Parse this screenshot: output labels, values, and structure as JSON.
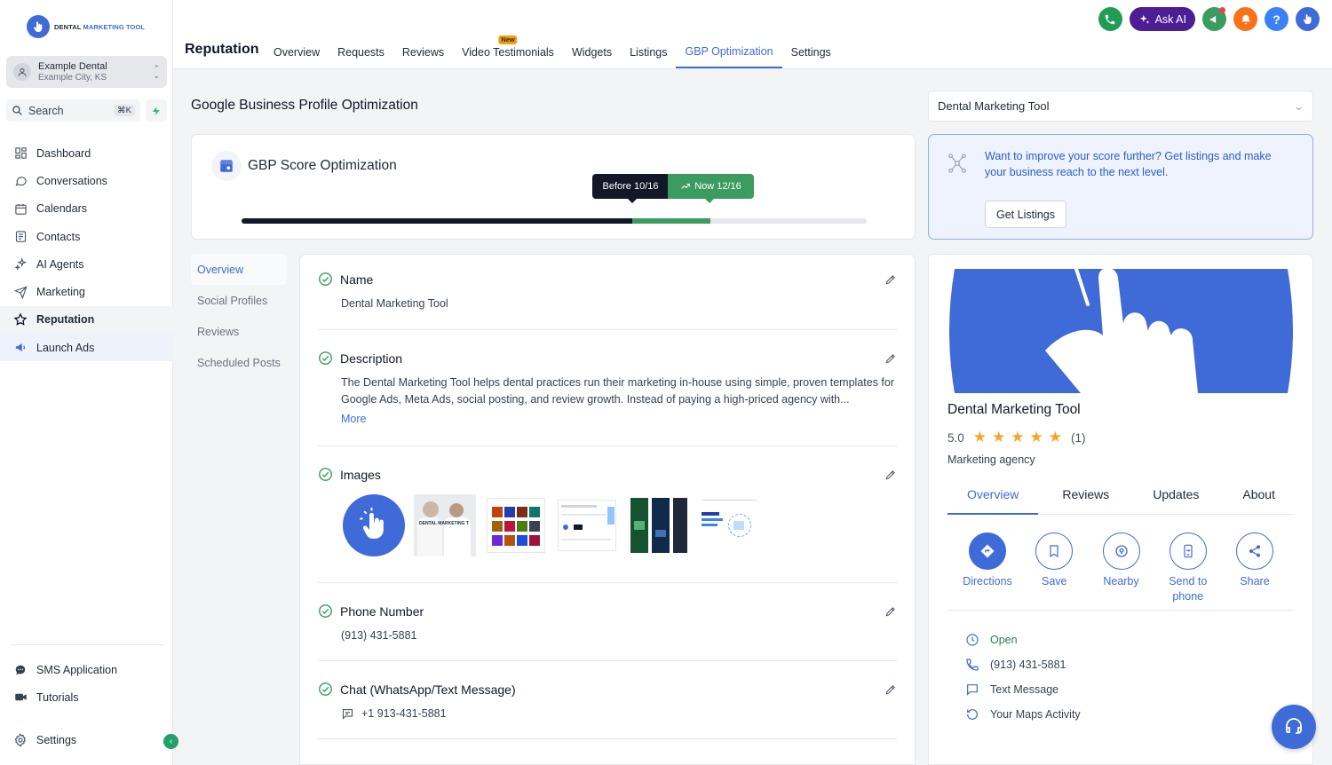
{
  "brand": {
    "logo_text_a": "DENTAL",
    "logo_text_b": "MARKETING TOOL",
    "accent": "#3f6bd8"
  },
  "location": {
    "name": "Example Dental",
    "sub": "Example City, KS"
  },
  "search": {
    "label": "Search",
    "shortcut": "⌘K"
  },
  "nav": {
    "items": [
      {
        "label": "Dashboard",
        "icon": "dashboard-icon"
      },
      {
        "label": "Conversations",
        "icon": "chat-bubble-icon"
      },
      {
        "label": "Calendars",
        "icon": "calendar-icon"
      },
      {
        "label": "Contacts",
        "icon": "contacts-icon"
      },
      {
        "label": "AI Agents",
        "icon": "sparkles-icon"
      },
      {
        "label": "Marketing",
        "icon": "send-icon"
      },
      {
        "label": "Reputation",
        "icon": "star-icon"
      },
      {
        "label": "Launch Ads",
        "icon": "megaphone-icon"
      }
    ],
    "bottom": [
      {
        "label": "SMS Application",
        "icon": "sms-icon"
      },
      {
        "label": "Tutorials",
        "icon": "video-icon"
      }
    ],
    "settings": "Settings"
  },
  "header": {
    "title": "Reputation",
    "tabs": [
      "Overview",
      "Requests",
      "Reviews",
      "Video Testimonials",
      "Widgets",
      "Listings",
      "GBP Optimization",
      "Settings"
    ],
    "new_badge": "New",
    "ask_ai": "Ask AI",
    "help": "?"
  },
  "main": {
    "title": "Google Business Profile Optimization",
    "select_value": "Dental Marketing Tool",
    "score": {
      "title": "GBP Score Optimization",
      "before_label": "Before 10/16",
      "now_label": "Now 12/16",
      "before_fraction": 0.625,
      "now_fraction": 0.75
    },
    "promo": {
      "text": "Want to improve your score further? Get listings and make your business reach to the next level.",
      "button": "Get Listings"
    },
    "side_tabs": [
      "Overview",
      "Social Profiles",
      "Reviews",
      "Scheduled Posts"
    ],
    "fields": {
      "name": {
        "label": "Name",
        "value": "Dental Marketing Tool"
      },
      "description": {
        "label": "Description",
        "value": "The Dental Marketing Tool helps dental practices run their marketing in-house using simple, proven templates for Google Ads, Meta Ads, social posting, and review growth. Instead of paying a high-priced agency with...",
        "more": "More"
      },
      "images": {
        "label": "Images",
        "thumb_caption": "DENTAL MARKETING T"
      },
      "phone": {
        "label": "Phone Number",
        "value": "(913) 431-5881"
      },
      "chat": {
        "label": "Chat (WhatsApp/Text Message)",
        "value": "+1 913-431-5881"
      }
    }
  },
  "profile": {
    "name": "Dental Marketing Tool",
    "rating": "5.0",
    "rating_count": "(1)",
    "stars": 5,
    "category": "Marketing agency",
    "tabs": [
      "Overview",
      "Reviews",
      "Updates",
      "About"
    ],
    "actions": [
      "Directions",
      "Save",
      "Nearby",
      "Send to phone",
      "Share"
    ],
    "info": {
      "open": "Open",
      "phone": "(913) 431-5881",
      "text": "Text Message",
      "activity": "Your Maps Activity"
    }
  },
  "colors": {
    "success": "#3a9c5e",
    "dark": "#111827",
    "ask_ai": "#4c1d95"
  }
}
